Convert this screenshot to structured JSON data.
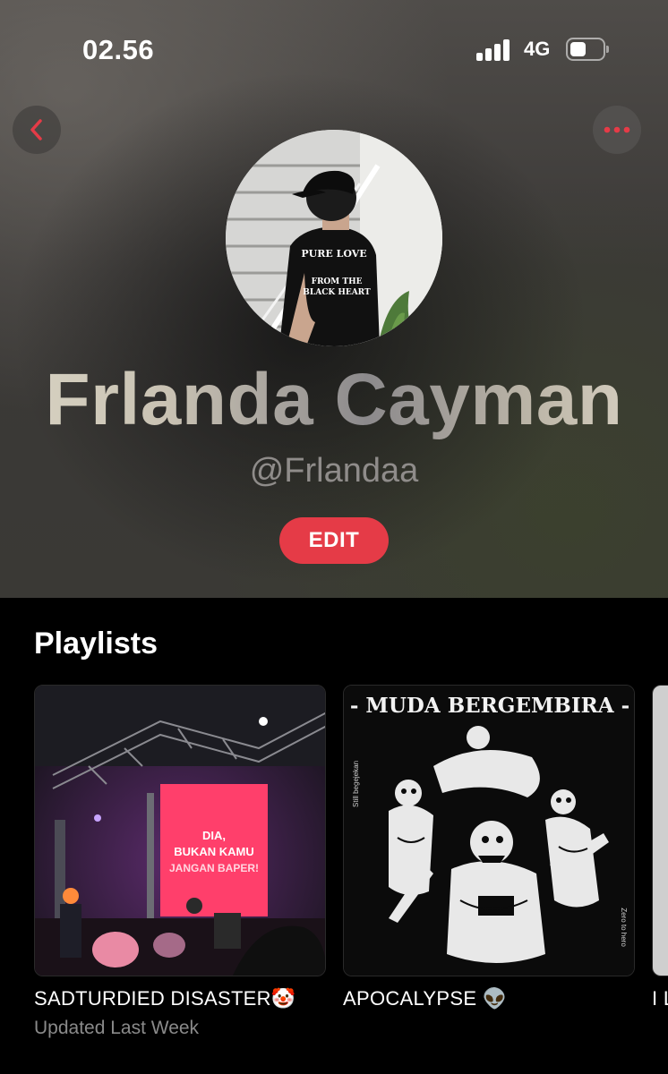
{
  "status_bar": {
    "time": "02.56",
    "network": "4G"
  },
  "profile": {
    "name": "Frlanda Cayman",
    "handle": "@Frlandaa",
    "edit_label": "EDIT",
    "shirt_text_line1": "PURE LOVE",
    "shirt_text_line2": "FROM THE",
    "shirt_text_line3": "BLACK HEART"
  },
  "playlists": {
    "heading": "Playlists",
    "items": [
      {
        "title": "SADTURDIED DISASTER🤡",
        "subtitle": "Updated Last Week",
        "art_text": [
          "DIA,",
          "BUKAN KAMU",
          "JANGAN BAPER!"
        ]
      },
      {
        "title": "APOCALYPSE 👽",
        "subtitle": "",
        "art_text": [
          "- MUDA BERGEMBIRA -",
          "Still begejekan",
          "Zero to hero"
        ]
      },
      {
        "title": "I L",
        "subtitle": ""
      }
    ]
  },
  "colors": {
    "accent": "#e53b47",
    "background": "#000000",
    "secondary_text": "#8a8a8a"
  },
  "icons": {
    "back": "chevron-left-icon",
    "more": "ellipsis-icon",
    "signal": "cellular-signal-icon",
    "battery": "battery-icon"
  }
}
